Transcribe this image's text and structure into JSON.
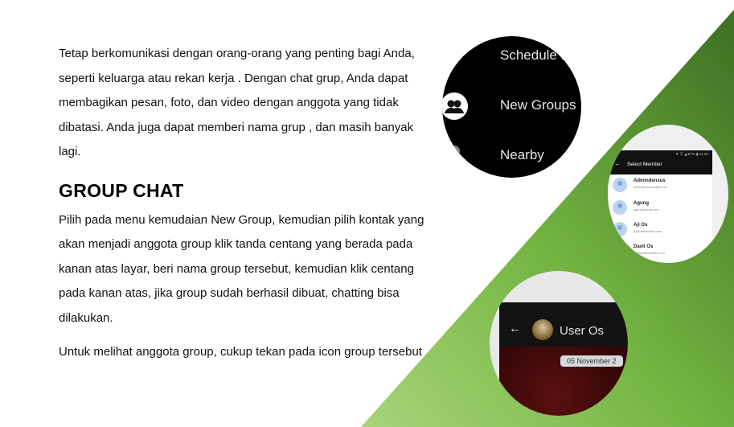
{
  "content": {
    "intro": "Tetap berkomunikasi dengan orang-orang yang penting bagi Anda, seperti keluarga atau rekan kerja . Dengan chat grup, Anda dapat membagikan pesan, foto, dan video dengan anggota yang tidak dibatasi. Anda juga dapat memberi nama grup , dan masih banyak lagi.",
    "heading": "GROUP CHAT",
    "steps": "Pilih pada menu kemudaian New Group, kemudian pilih kontak yang akan menjadi anggota group klik tanda centang yang berada pada kanan atas layar, beri nama group tersebut, kemudian klik centang pada kanan atas, jika group sudah berhasil dibuat, chatting bisa dilakukan.",
    "note": "Untuk melihat anggota group, cukup tekan pada icon group tersebut"
  },
  "menu_circle": {
    "items": [
      "Schedule M",
      "New Groups",
      "Nearby"
    ]
  },
  "select_member_circle": {
    "status_text": "▼ ☰ ◢ 87% ▮ 11:28",
    "title": "Select Member",
    "members": [
      {
        "name": "Admindensus",
        "email": "admin@densusdfist.com"
      },
      {
        "name": "Agung",
        "email": "agung@ymail.com"
      },
      {
        "name": "Aji Os",
        "email": "aji@densusdfist.com"
      },
      {
        "name": "Davit Os",
        "email": "davit@densusdfist.com"
      }
    ]
  },
  "chat_circle": {
    "user": "User Os",
    "date": "05 November 2"
  },
  "colors": {
    "green_light": "#9ccc6a",
    "green_dark": "#3f7a26"
  }
}
